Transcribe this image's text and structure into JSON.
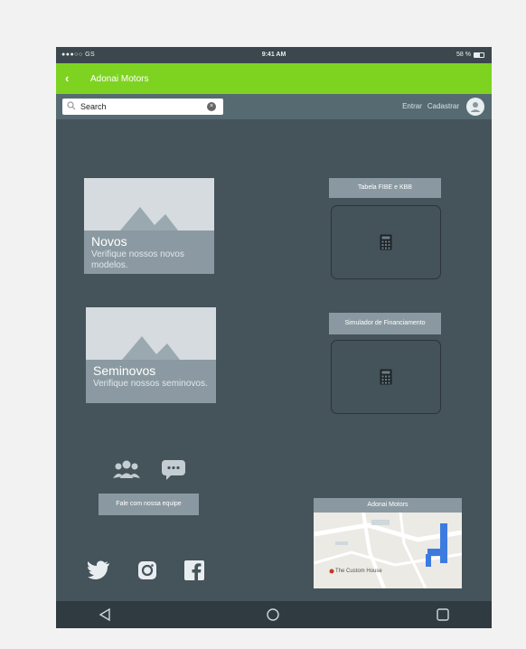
{
  "status_bar": {
    "carrier": "●●●○○ GS",
    "time": "9:41 AM",
    "battery": "58 %"
  },
  "app_bar": {
    "title": "Adonai Motors"
  },
  "search": {
    "text": "Search"
  },
  "top_links": {
    "login": "Entrar",
    "register": "Cadastrar"
  },
  "cards": [
    {
      "title": "Novos",
      "description": "Verifique nossos novos modelos."
    },
    {
      "title": "Seminovos",
      "description": "Verifique nossos seminovos."
    }
  ],
  "tools": [
    {
      "label": "Tabela FIBE e KBB"
    },
    {
      "label": "Simulador de Financiamento"
    }
  ],
  "team_button": {
    "label": "Fale com nossa equipe"
  },
  "map": {
    "label": "Adonai Motors",
    "place": "The Custom House"
  },
  "colors": {
    "accent": "#7ed321",
    "background": "#45535a",
    "panel": "#8a99a1"
  }
}
